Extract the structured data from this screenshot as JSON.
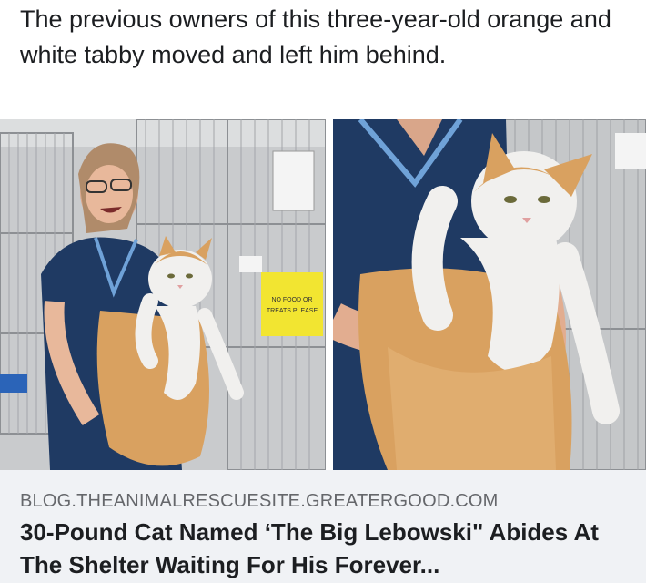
{
  "post": {
    "text": "The previous owners of this three-year-old orange and white tabby moved and left him behind."
  },
  "photos": {
    "left": {
      "sign_text": "NO FOOD OR TREATS PLEASE"
    }
  },
  "link_preview": {
    "domain": "BLOG.THEANIMALRESCUESITE.GREATERGOOD.COM",
    "title": "30-Pound Cat Named ‘The Big Lebowski\" Abides At The Shelter Waiting For His Forever..."
  },
  "colors": {
    "scrub_blue": "#1f3a63",
    "cat_orange": "#d9a160",
    "cage_gray": "#b9bcbf",
    "sign_yellow": "#f2e531"
  }
}
